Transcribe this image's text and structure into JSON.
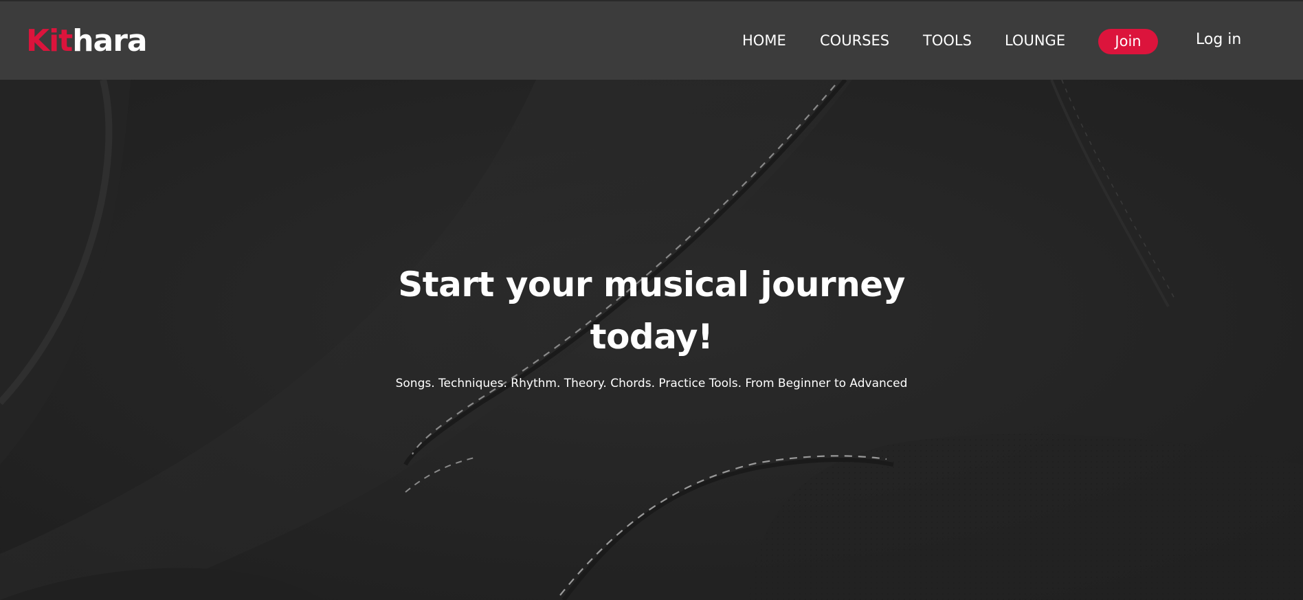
{
  "header": {
    "logo": {
      "part1": "Kit",
      "part2": "hara"
    },
    "nav": [
      {
        "label": "HOME"
      },
      {
        "label": "COURSES"
      },
      {
        "label": "TOOLS"
      },
      {
        "label": "LOUNGE"
      }
    ],
    "join_label": "Join",
    "login_label": "Log in"
  },
  "hero": {
    "title": "Start your musical journey today!",
    "subtitle": "Songs. Techniques. Rhythm. Theory. Chords. Practice Tools. From Beginner to Advanced"
  },
  "colors": {
    "accent": "#dc143c",
    "navbar": "#3c3c3c",
    "hero_background": "#262626",
    "text": "#ffffff"
  }
}
